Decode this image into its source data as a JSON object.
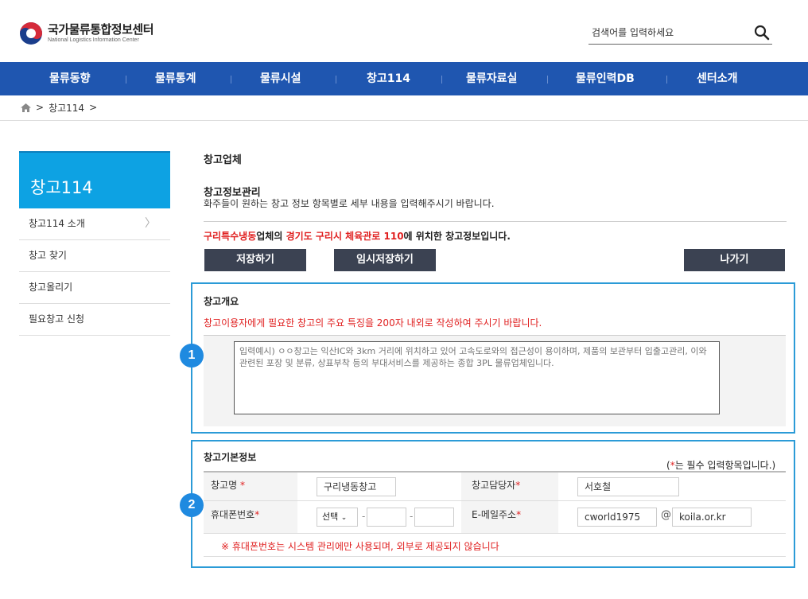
{
  "header": {
    "logo_title": "국가물류통합정보센터",
    "logo_subtitle": "National Logistics Information Center",
    "search_placeholder": "검색어를 입력하세요"
  },
  "nav": [
    "물류동향",
    "물류통계",
    "물류시설",
    "창고114",
    "물류자료실",
    "물류인력DB",
    "센터소개"
  ],
  "breadcrumb": {
    "current": "창고114",
    "sep": ">"
  },
  "sidebar": {
    "title": "창고114",
    "items": [
      "창고114 소개",
      "창고 찾기",
      "창고올리기",
      "필요창고 신청"
    ]
  },
  "main": {
    "title": "창고업체",
    "manage_title": "창고정보관리",
    "manage_desc": "화주들이 원하는 창고 정보 항목별로 세부 내용을 입력해주시기 바랍니다.",
    "location": {
      "company": "구리특수냉동",
      "mid1": "업체의 ",
      "address": "경기도 구리시 체육관로 110",
      "tail": "에 위치한 창고정보입니다."
    },
    "buttons": {
      "save": "저장하기",
      "temp_save": "임시저장하기",
      "exit": "나가기"
    }
  },
  "overview": {
    "badge": "1",
    "title": "창고개요",
    "note": "창고이용자에게 필요한 창고의 주요 특징을 200자 내외로 작성하여 주시기 바랍니다.",
    "placeholder": "입력예시) ㅇㅇ창고는 익산IC와 3km 거리에 위치하고 있어 고속도로와의 접근성이 용이하며, 제품의 보관부터 입출고관리, 이와 관련된 포장 및 분류, 상표부착 등의 부대서비스를 제공하는 종합 3PL 물류업체입니다."
  },
  "basic": {
    "badge": "2",
    "title": "창고기본정보",
    "required_note_open": "(",
    "required_note_star": "*",
    "required_note_text": "는 필수 입력항목입니다.)",
    "fields": {
      "name_label": "창고명",
      "name_value": "구리냉동창고",
      "manager_label": "창고담당자",
      "manager_value": "서호철",
      "phone_label": "휴대폰번호",
      "phone_select": "선택",
      "email_label": "E-메일주소",
      "email_user": "cworld1975",
      "email_at": "@",
      "email_domain": "koila.or.kr",
      "star": "*"
    },
    "phone_notice": "※ 휴대폰번호는 시스템 관리에만 사용되며, 외부로 제공되지 않습니다"
  }
}
